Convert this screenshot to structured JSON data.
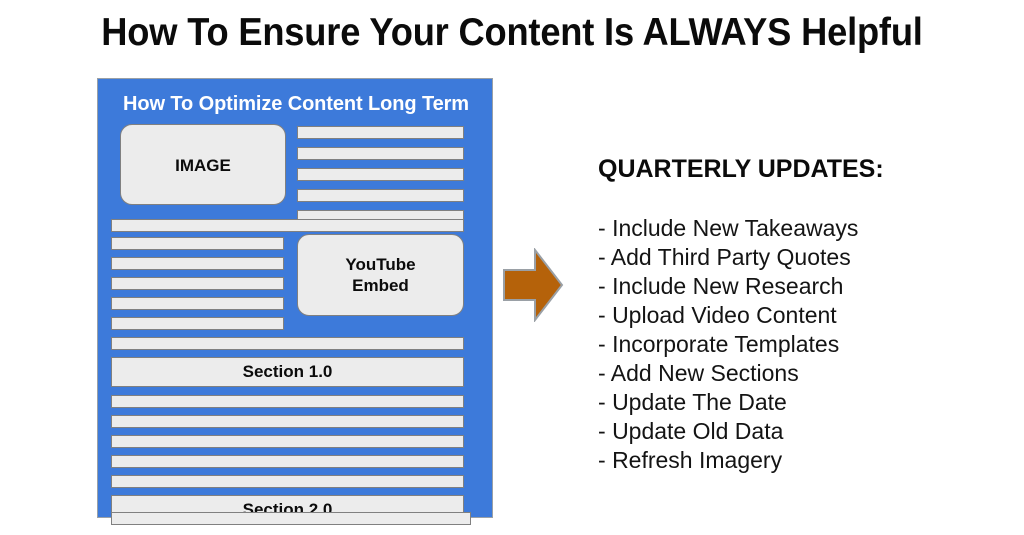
{
  "title": "How To Ensure Your Content Is ALWAYS Helpful",
  "colors": {
    "panel_blue": "#3d7ada",
    "box_gray": "#ececec",
    "box_border": "#808080",
    "arrow_orange": "#b5620a",
    "arrow_border": "#9aa0a6",
    "text_black": "#0b0b0b",
    "heading_white": "#ffffff"
  },
  "document_mock": {
    "heading": "How To Optimize Content Long Term",
    "image_placeholder": "IMAGE",
    "video_placeholder": "YouTube\nEmbed",
    "video_placeholder_line1": "YouTube",
    "video_placeholder_line2": "Embed",
    "sections": [
      {
        "label": "Section 1.0"
      },
      {
        "label": "Section 2.0"
      }
    ],
    "text_line_counts": {
      "top_right_column_lines": 5,
      "full_width_after_image": 1,
      "left_column_beside_video": 5,
      "full_width_before_section1": 1,
      "full_width_between_sections": 5,
      "full_width_below_panel": 1
    }
  },
  "arrow": {
    "direction": "right",
    "icon_name": "right-arrow-icon"
  },
  "updates": {
    "heading": "QUARTERLY UPDATES:",
    "bullet_prefix": "- ",
    "items": [
      "Include New Takeaways",
      "Add Third Party Quotes",
      "Include New Research",
      "Upload Video Content",
      "Incorporate Templates",
      "Add New Sections",
      "Update The Date",
      "Update Old Data",
      "Refresh Imagery"
    ]
  }
}
